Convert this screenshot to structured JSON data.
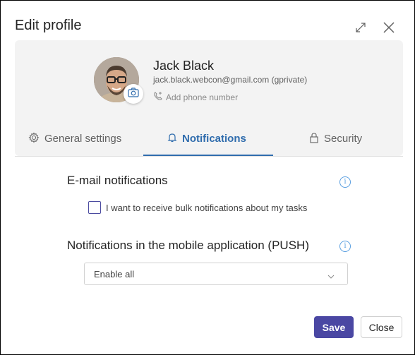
{
  "dialog": {
    "title": "Edit profile",
    "icons": {
      "expand": "expand-icon",
      "close": "close-icon"
    }
  },
  "profile": {
    "name": "Jack Black",
    "email": "jack.black.webcon@gmail.com (gprivate)",
    "phone_placeholder": "Add phone number",
    "avatar": "avatar-photo",
    "change_photo_icon": "camera-icon"
  },
  "tabs": [
    {
      "label": "General settings",
      "icon": "gear-icon",
      "active": false
    },
    {
      "label": "Notifications",
      "icon": "bell-icon",
      "active": true
    },
    {
      "label": "Security",
      "icon": "lock-icon",
      "active": false
    }
  ],
  "email_notifications": {
    "title": "E-mail notifications",
    "checkbox_label": "I want to receive bulk notifications about my tasks",
    "checked": false,
    "info_icon": "i"
  },
  "push_notifications": {
    "title": "Notifications in the mobile application (PUSH)",
    "selected": "Enable all",
    "info_icon": "i"
  },
  "footer": {
    "save_label": "Save",
    "close_label": "Close"
  },
  "colors": {
    "accent": "#2f6cad",
    "primary_button": "#4a47a3",
    "info": "#5a9fe0"
  }
}
